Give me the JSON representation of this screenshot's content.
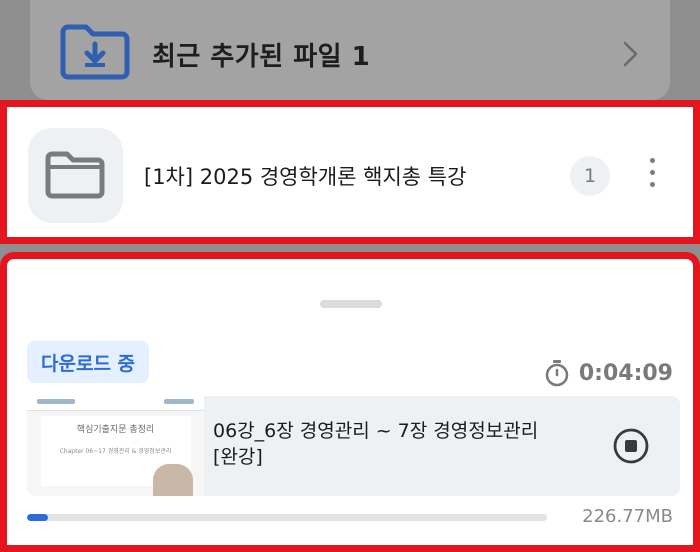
{
  "recent": {
    "title": "최근 추가된 파일 1",
    "icon": "download-folder-icon"
  },
  "folder_item": {
    "title": "[1차] 2025 경영학개론 핵지총 특강",
    "count": "1",
    "icon": "folder-icon"
  },
  "download": {
    "status": "다운로드 중",
    "elapsed": "0:04:09",
    "item": {
      "title": "06강_6장 경영관리 ~ 7장 경영정보관리 [완강]",
      "thumbnail_title": "핵심기출지문 총정리",
      "thumbnail_subtitle": "Chapter 06~17 경영관리 & 경영정보관리"
    },
    "progress": 0.04,
    "size": "226.77MB"
  },
  "colors": {
    "accent": "#2d6cd8",
    "highlight_border": "#e4151d",
    "chip_bg": "#e4efff"
  }
}
